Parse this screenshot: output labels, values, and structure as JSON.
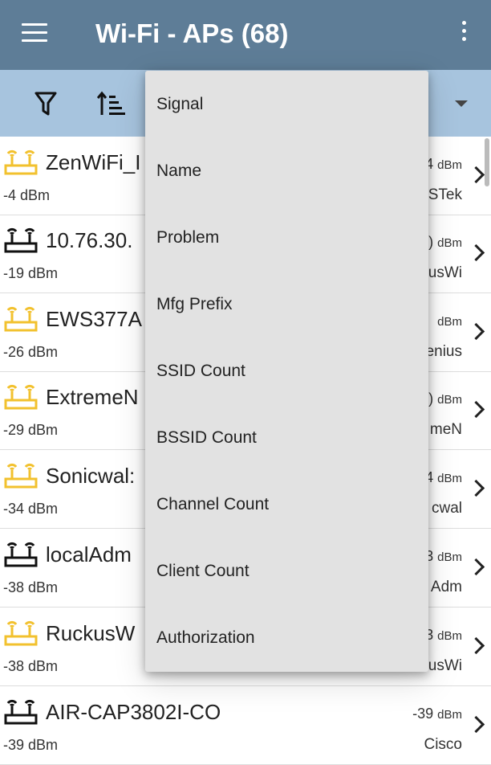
{
  "appbar": {
    "title": "Wi-Fi - APs (68)",
    "menu_icon": "hamburger-menu-icon",
    "overflow_icon": "more-vertical-icon",
    "background": "#5e7d97"
  },
  "toolbar": {
    "filter_icon": "filter-icon",
    "sort_icon": "sort-icon",
    "dropdown_icon": "caret-down-icon",
    "background": "#a7c4de"
  },
  "sort_menu": {
    "items": [
      "Signal",
      "Name",
      "Problem",
      "Mfg Prefix",
      "SSID Count",
      "BSSID Count",
      "Channel Count",
      "Client Count",
      "Authorization"
    ]
  },
  "access_points": [
    {
      "name": "ZenWiFi_I",
      "signal": "-4 dBm",
      "right_value": "4",
      "right_unit": "dBm",
      "mfg": "STek",
      "icon_color": "yellow"
    },
    {
      "name": "10.76.30.",
      "signal": "-19 dBm",
      "right_value": ")",
      "right_unit": "dBm",
      "mfg": "usWi",
      "icon_color": "black"
    },
    {
      "name": "EWS377A",
      "signal": "-26 dBm",
      "right_value": "",
      "right_unit": "dBm",
      "mfg": "enius",
      "icon_color": "yellow"
    },
    {
      "name": "ExtremeN",
      "signal": "-29 dBm",
      "right_value": ")",
      "right_unit": "dBm",
      "mfg": "meN",
      "icon_color": "yellow"
    },
    {
      "name": "Sonicwal:",
      "signal": "-34 dBm",
      "right_value": "4",
      "right_unit": "dBm",
      "mfg": "cwal",
      "icon_color": "yellow"
    },
    {
      "name": "localAdm",
      "signal": "-38 dBm",
      "right_value": "3",
      "right_unit": "dBm",
      "mfg": "Adm",
      "icon_color": "black"
    },
    {
      "name": "RuckusW",
      "signal": "-38 dBm",
      "right_value": "3",
      "right_unit": "dBm",
      "mfg": "usWi",
      "icon_color": "yellow"
    },
    {
      "name": "AIR-CAP3802I-CO",
      "signal": "-39 dBm",
      "right_value": "-39",
      "right_unit": "dBm",
      "mfg": "Cisco",
      "icon_color": "black"
    }
  ],
  "row_icon": "access-point-router-icon",
  "row_chevron_icon": "chevron-right-icon"
}
